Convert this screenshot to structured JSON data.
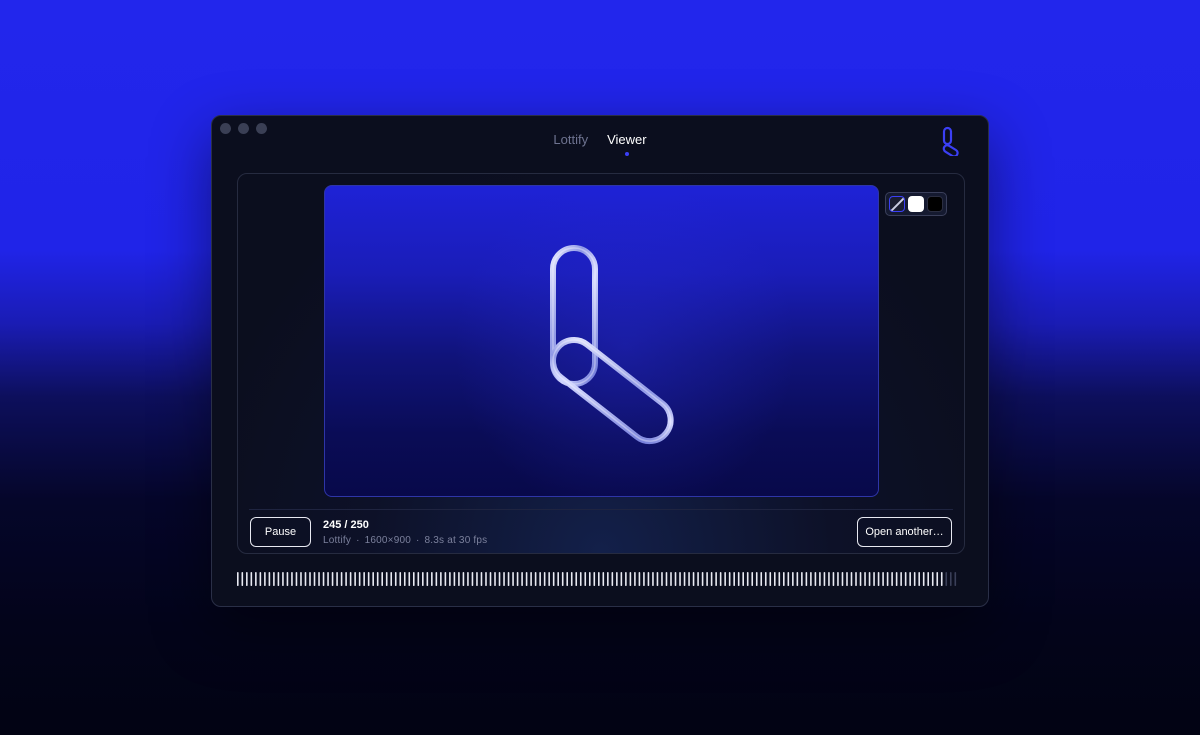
{
  "nav": {
    "tabs": [
      {
        "label": "Lottify",
        "active": false
      },
      {
        "label": "Viewer",
        "active": true
      }
    ]
  },
  "viewer": {
    "background_options": [
      "transparent",
      "white",
      "black"
    ],
    "selected_background": "transparent"
  },
  "controls": {
    "pause_label": "Pause",
    "open_label": "Open another…",
    "frame": "245 / 250",
    "meta": {
      "name": "Lottify",
      "dimensions": "1600×900",
      "duration": "8.3s at 30 fps",
      "separator": "·"
    }
  },
  "timeline": {
    "progress": 0.98,
    "total_frames": 250,
    "current_frame": 245
  },
  "colors": {
    "accent": "#3b3ff5",
    "window_bg": "#0b0e1e",
    "stage_top": "#1e22d6",
    "stage_bottom": "#08094a"
  },
  "icons": {
    "logo": "link-chain-logo-icon",
    "stage_content": "chrome-link-chain-icon"
  }
}
